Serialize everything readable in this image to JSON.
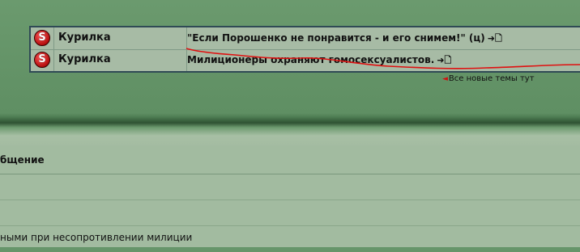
{
  "topics": [
    {
      "forum": "Курилка",
      "title": "\"Если Порошенко не понравится - и его снимем!\" (ц)",
      "go_icon": "➜🗋"
    },
    {
      "forum": "Курилка",
      "title": "Милиционеры охраняют гомосексуалистов.",
      "go_icon": "➜🗋"
    }
  ],
  "icon_letter": "S",
  "all_new_label": "Все новые темы тут",
  "arrow_glyph": "◄",
  "section_heading": "бщение",
  "message_snippet": "ными при несопротивлении милиции",
  "colors": {
    "annotation": "#e01010",
    "table_border": "#2f4a55",
    "background": "#66956a"
  }
}
